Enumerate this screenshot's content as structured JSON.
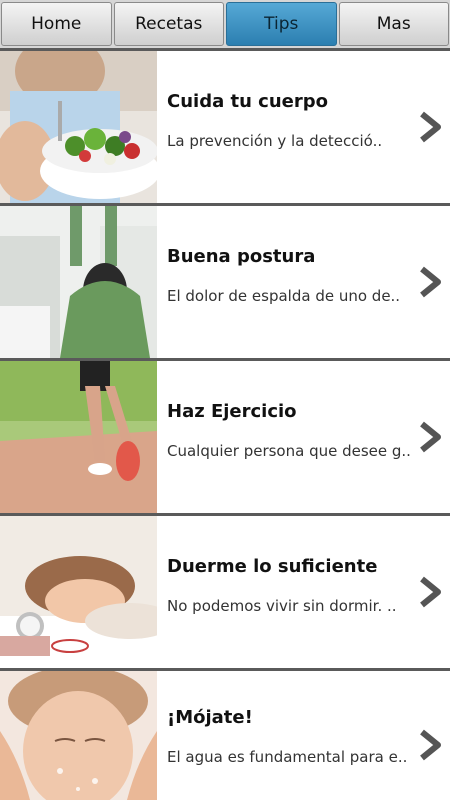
{
  "tabs": [
    {
      "label": "Home",
      "active": false
    },
    {
      "label": "Recetas",
      "active": false
    },
    {
      "label": "Tips",
      "active": true
    },
    {
      "label": "Mas",
      "active": false
    }
  ],
  "items": [
    {
      "title": "Cuida tu cuerpo",
      "desc": "La prevención y la detecció..",
      "image": "woman-salad-photo"
    },
    {
      "title": "Buena postura",
      "desc": "El dolor de espalda de uno de..",
      "image": "stretching-back-photo"
    },
    {
      "title": "Haz Ejercicio",
      "desc": "Cualquier persona que desee g..",
      "image": "running-legs-photo"
    },
    {
      "title": "Duerme lo suficiente",
      "desc": "No podemos vivir sin dormir. ..",
      "image": "sleeping-woman-photo"
    },
    {
      "title": "¡Mójate!",
      "desc": "El agua es fundamental para e..",
      "image": "face-washing-photo"
    }
  ],
  "colors": {
    "active_tab": "#3a95c7",
    "background": "#5a5a5a"
  }
}
